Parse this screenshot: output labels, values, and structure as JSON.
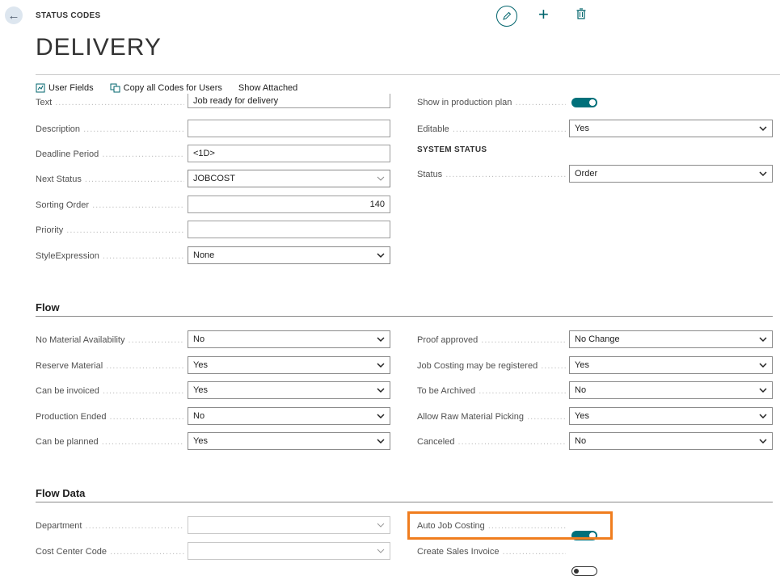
{
  "header": {
    "breadcrumb": "STATUS CODES",
    "title": "DELIVERY"
  },
  "actions": {
    "user_fields": "User Fields",
    "copy_codes": "Copy all Codes for Users",
    "show_attached": "Show Attached"
  },
  "general": {
    "text_label": "Text",
    "text_value": "Job ready for delivery",
    "description_label": "Description",
    "description_value": "",
    "deadline_label": "Deadline Period",
    "deadline_value": "<1D>",
    "next_status_label": "Next Status",
    "next_status_value": "JOBCOST",
    "sorting_label": "Sorting Order",
    "sorting_value": "140",
    "priority_label": "Priority",
    "priority_value": "",
    "style_label": "StyleExpression",
    "style_value": "None",
    "show_in_plan_label": "Show in production plan",
    "show_in_plan": true,
    "editable_label": "Editable",
    "editable_value": "Yes",
    "system_status_heading": "SYSTEM STATUS",
    "status_label": "Status",
    "status_value": "Order"
  },
  "flow": {
    "heading": "Flow",
    "left": [
      {
        "label": "No Material Availability",
        "value": "No"
      },
      {
        "label": "Reserve Material",
        "value": "Yes"
      },
      {
        "label": "Can be invoiced",
        "value": "Yes"
      },
      {
        "label": "Production Ended",
        "value": "No"
      },
      {
        "label": "Can be planned",
        "value": "Yes"
      }
    ],
    "right": [
      {
        "label": "Proof approved",
        "value": "No Change"
      },
      {
        "label": "Job Costing may be registered",
        "value": "Yes"
      },
      {
        "label": "To be Archived",
        "value": "No"
      },
      {
        "label": "Allow Raw Material Picking",
        "value": "Yes"
      },
      {
        "label": "Canceled",
        "value": "No"
      }
    ]
  },
  "flow_data": {
    "heading": "Flow Data",
    "department_label": "Department",
    "department_value": "",
    "cost_center_label": "Cost Center Code",
    "cost_center_value": "",
    "auto_job_costing_label": "Auto Job Costing",
    "auto_job_costing": true,
    "create_sales_invoice_label": "Create Sales Invoice",
    "create_sales_invoice": false
  },
  "colors": {
    "accent": "#00707a",
    "highlight": "#f07d1e"
  }
}
